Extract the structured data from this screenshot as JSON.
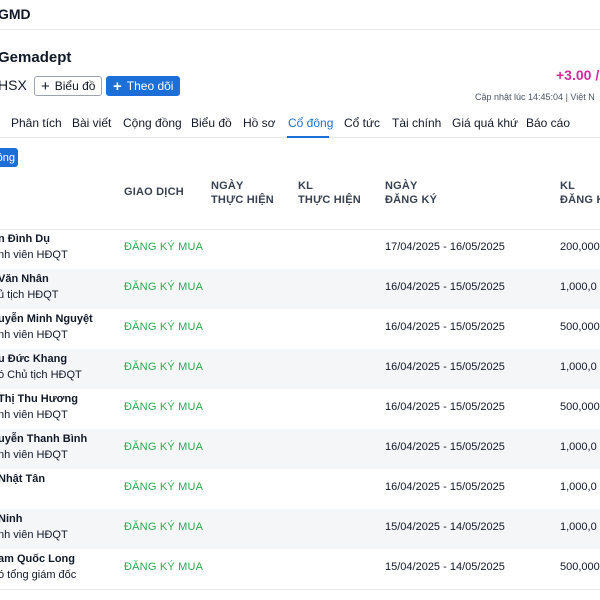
{
  "header": {
    "ticker": "GMD"
  },
  "company": {
    "name": "Gemadept",
    "exchange": "HSX",
    "chart_button": "Biểu đồ",
    "follow_button": "Theo dõi",
    "price_change": "+3.00 /",
    "update_label": "Cập nhật lúc  14:45:04 | Việt N"
  },
  "tabs": [
    {
      "label": "Phân tích",
      "active": false
    },
    {
      "label": "Bài viết",
      "active": false
    },
    {
      "label": "Cộng đồng",
      "active": false
    },
    {
      "label": "Biểu đồ",
      "active": false
    },
    {
      "label": "Hồ sơ",
      "active": false
    },
    {
      "label": "Cổ đông",
      "active": true
    },
    {
      "label": "Cổ tức",
      "active": false
    },
    {
      "label": "Tài chính",
      "active": false
    },
    {
      "label": "Giá quá khứ",
      "active": false
    },
    {
      "label": "Báo cáo",
      "active": false
    }
  ],
  "subtab": {
    "label": "ông"
  },
  "table": {
    "headers": {
      "transaction": "GIAO DỊCH",
      "exec_date_1": "NGÀY",
      "exec_date_2": "THỰC HIỆN",
      "exec_qty_1": "KL",
      "exec_qty_2": "THỰC HIỆN",
      "reg_date_1": "NGÀY",
      "reg_date_2": "ĐĂNG KÝ",
      "reg_qty_1": "KL",
      "reg_qty_2": "ĐĂNG K"
    },
    "rows": [
      {
        "name": "n Đình Dụ",
        "role": "nh viên HĐQT",
        "action": "ĐĂNG KÝ MUA",
        "period": "17/04/2025 - 16/05/2025",
        "qty": "200,000"
      },
      {
        "name": "Văn Nhân",
        "role": "ủ tịch HĐQT",
        "action": "ĐĂNG KÝ MUA",
        "period": "16/04/2025 - 15/05/2025",
        "qty": "1,000,0"
      },
      {
        "name": "uyễn Minh Nguyệt",
        "role": "nh viên HĐQT",
        "action": "ĐĂNG KÝ MUA",
        "period": "16/04/2025 - 15/05/2025",
        "qty": "500,000"
      },
      {
        "name": "u Đức Khang",
        "role": "ó Chủ tịch HĐQT",
        "action": "ĐĂNG KÝ MUA",
        "period": "16/04/2025 - 15/05/2025",
        "qty": "1,000,0"
      },
      {
        "name": "Thị Thu Hương",
        "role": "nh viên HĐQT",
        "action": "ĐĂNG KÝ MUA",
        "period": "16/04/2025 - 15/05/2025",
        "qty": "500,000"
      },
      {
        "name": "uyễn Thanh Bình",
        "role": "nh viên HĐQT",
        "action": "ĐĂNG KÝ MUA",
        "period": "16/04/2025 - 15/05/2025",
        "qty": "1,000,0"
      },
      {
        "name": "Nhật Tân",
        "role": "",
        "action": "ĐĂNG KÝ MUA",
        "period": "16/04/2025 - 15/05/2025",
        "qty": "1,000,0"
      },
      {
        "name": "Ninh",
        "role": "nh viên HĐQT",
        "action": "ĐĂNG KÝ MUA",
        "period": "15/04/2025 - 14/05/2025",
        "qty": "1,000,0"
      },
      {
        "name": "am Quốc Long",
        "role": "ó tổng giám đốc",
        "action": "ĐĂNG KÝ MUA",
        "period": "15/04/2025 - 14/05/2025",
        "qty": "500,000"
      }
    ]
  },
  "colors": {
    "accent": "#1d6fd8",
    "buy_green": "#2fa84f",
    "price_magenta": "#d6299d",
    "row_alt": "#f5f6f8"
  }
}
